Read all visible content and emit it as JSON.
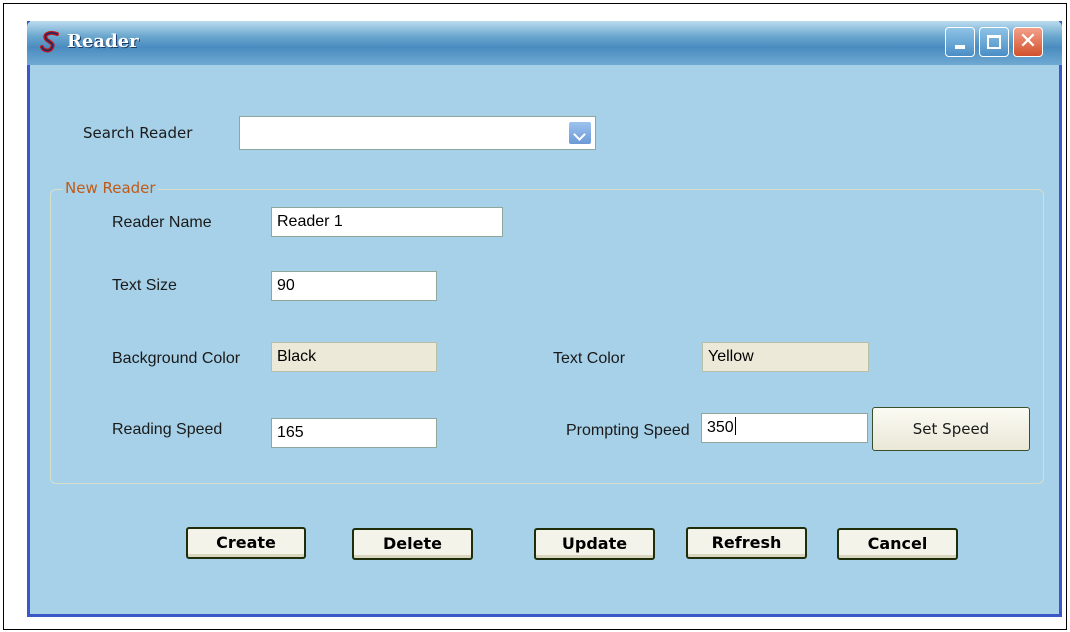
{
  "window": {
    "title": "Reader",
    "icon": "app-logo-icon"
  },
  "search": {
    "label": "Search Reader",
    "value": ""
  },
  "group": {
    "legend": "New Reader"
  },
  "fields": {
    "reader_name": {
      "label": "Reader Name",
      "value": "Reader 1"
    },
    "text_size": {
      "label": "Text Size",
      "value": "90"
    },
    "background_color": {
      "label": "Background Color",
      "value": "Black"
    },
    "text_color": {
      "label": "Text Color",
      "value": "Yellow"
    },
    "reading_speed": {
      "label": "Reading Speed",
      "value": "165"
    },
    "prompting_speed": {
      "label": "Prompting Speed",
      "value": "350"
    }
  },
  "buttons": {
    "set_speed": "Set Speed",
    "create": "Create",
    "delete": "Delete",
    "update": "Update",
    "refresh": "Refresh",
    "cancel": "Cancel"
  },
  "colors": {
    "window_background": "#a6d1e8",
    "title_bar": "#4a8cc0",
    "group_legend": "#c05a16"
  }
}
